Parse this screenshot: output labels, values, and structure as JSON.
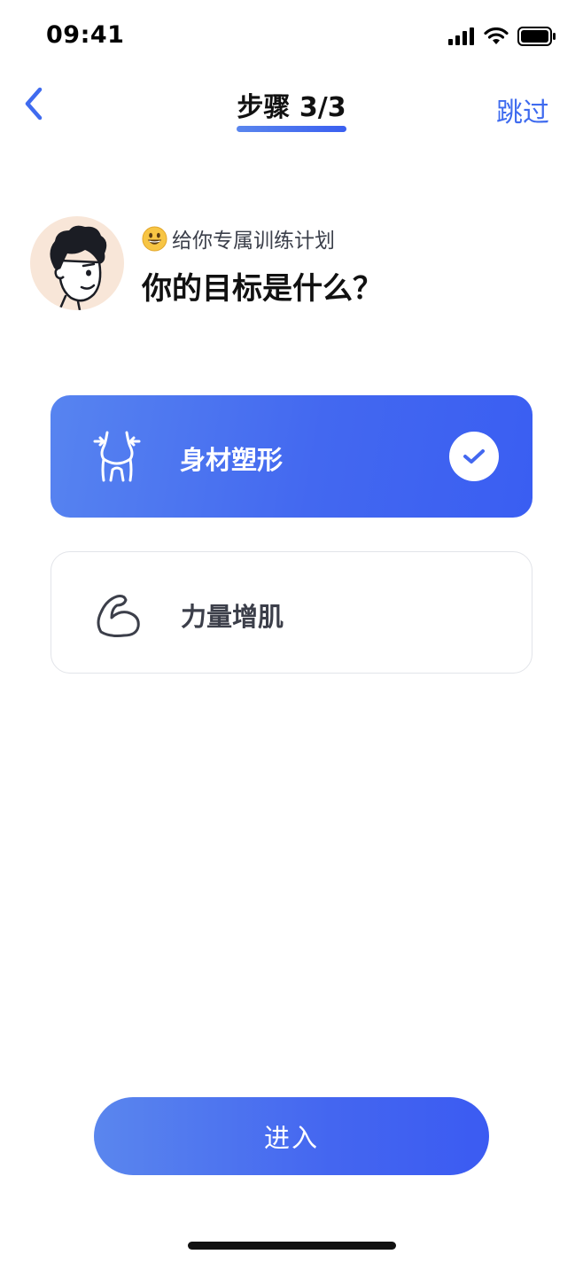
{
  "status_bar": {
    "time": "09:41",
    "icons": [
      "cellular-signal-icon",
      "wifi-icon",
      "battery-icon"
    ]
  },
  "nav": {
    "back_icon": "chevron-left-icon",
    "title": "步骤 3/3",
    "skip_label": "跳过"
  },
  "intro": {
    "avatar": "cartoon-avatar",
    "emoji": "grinning-face-emoji",
    "subtitle": "给你专属训练计划",
    "question": "你的目标是什么？"
  },
  "options": [
    {
      "label": "身材塑形",
      "icon": "waist-shaping-icon",
      "selected": true
    },
    {
      "label": "力量增肌",
      "icon": "flexed-arm-icon",
      "selected": false
    }
  ],
  "primary_button": {
    "label": "进入"
  },
  "colors": {
    "accent": "#3f6bef",
    "gradient_start": "#5784f0",
    "gradient_end": "#3a5ef2",
    "text_primary": "#111111",
    "text_secondary": "#3c3f4a"
  }
}
